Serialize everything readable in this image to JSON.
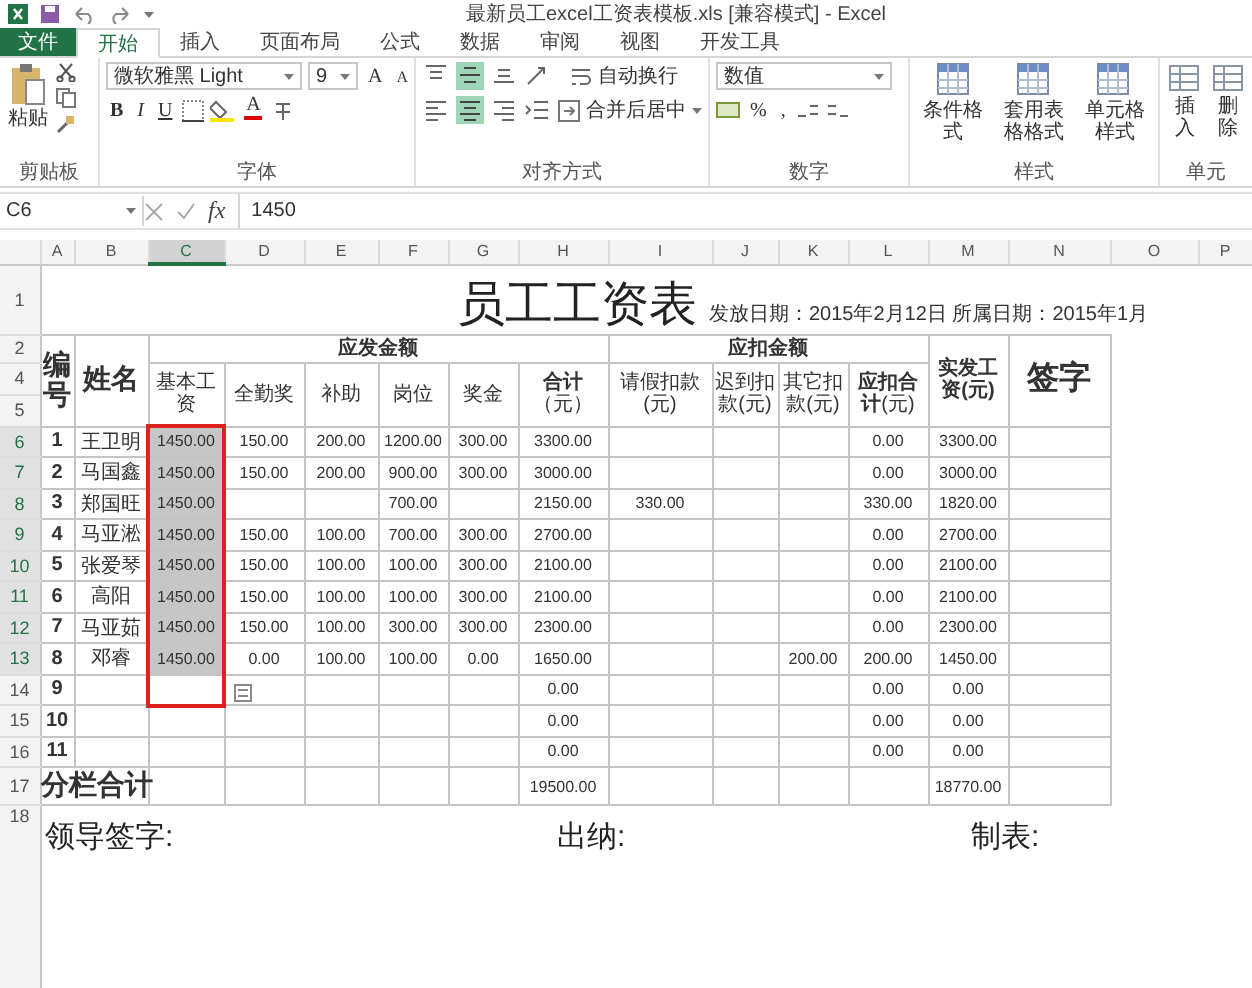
{
  "window": {
    "title": "最新员工excel工资表模板.xls  [兼容模式] - Excel"
  },
  "tabs": [
    {
      "label": "文件",
      "kind": "file",
      "selected": false
    },
    {
      "label": "开始",
      "kind": "tab",
      "selected": true
    },
    {
      "label": "插入",
      "kind": "tab",
      "selected": false
    },
    {
      "label": "页面布局",
      "kind": "tab",
      "selected": false
    },
    {
      "label": "公式",
      "kind": "tab",
      "selected": false
    },
    {
      "label": "数据",
      "kind": "tab",
      "selected": false
    },
    {
      "label": "审阅",
      "kind": "tab",
      "selected": false
    },
    {
      "label": "视图",
      "kind": "tab",
      "selected": false
    },
    {
      "label": "开发工具",
      "kind": "tab",
      "selected": false
    }
  ],
  "ribbon": {
    "clipboard": {
      "paste": "粘贴",
      "label": "剪贴板"
    },
    "font": {
      "name": "微软雅黑 Light",
      "size": "9",
      "bold": "B",
      "italic": "I",
      "underline": "U",
      "grow": "A",
      "shrink": "A",
      "color_button": "A",
      "label": "字体"
    },
    "alignment": {
      "vertical": [
        {
          "kind": "top",
          "selected": false
        },
        {
          "kind": "middle",
          "selected": true
        },
        {
          "kind": "bottom",
          "selected": false
        }
      ],
      "horizontal": [
        {
          "kind": "left",
          "selected": false
        },
        {
          "kind": "center",
          "selected": true
        },
        {
          "kind": "right",
          "selected": false
        }
      ],
      "wrap": "自动换行",
      "merge": "合并后居中",
      "label": "对齐方式"
    },
    "number": {
      "format": "数值",
      "percent": "%",
      "comma": ",",
      "label": "数字"
    },
    "styles": {
      "buttons": [
        "条件格式",
        "套用表格格式",
        "单元格样式"
      ],
      "label": "样式"
    },
    "cells": {
      "buttons": [
        "插入",
        "删除"
      ],
      "label": "单元"
    }
  },
  "formula_bar": {
    "name_box": "C6",
    "fx": "fx",
    "value": "1450"
  },
  "sheet": {
    "columns": [
      {
        "label": "A",
        "selected": false
      },
      {
        "label": "B",
        "selected": false
      },
      {
        "label": "C",
        "selected": true
      },
      {
        "label": "D",
        "selected": false
      },
      {
        "label": "E",
        "selected": false
      },
      {
        "label": "F",
        "selected": false
      },
      {
        "label": "G",
        "selected": false
      },
      {
        "label": "H",
        "selected": false
      },
      {
        "label": "I",
        "selected": false
      },
      {
        "label": "J",
        "selected": false
      },
      {
        "label": "K",
        "selected": false
      },
      {
        "label": "L",
        "selected": false
      },
      {
        "label": "M",
        "selected": false
      },
      {
        "label": "N",
        "selected": false
      },
      {
        "label": "O",
        "selected": false
      },
      {
        "label": "P",
        "selected": false
      }
    ],
    "title_row": {
      "number": "1",
      "title": "员工工资表",
      "dates": "发放日期：2015年2月12日 所属日期：2015年1月"
    },
    "header": {
      "numbers": [
        "2",
        "4",
        "5"
      ],
      "id": "编号",
      "name": "姓名",
      "earn_group": "应发金额",
      "earn_columns": [
        "基本工资",
        "全勤奖",
        "补助",
        "岗位",
        "奖金",
        "**合计**（元）"
      ],
      "deduct_group": "应扣金额",
      "deduct_columns": [
        "请假扣款(元)",
        "迟到扣款(元)",
        "其它扣款(元)",
        "**应扣合计**(元)"
      ],
      "net": "实发工资(元)",
      "sign": "签字"
    },
    "rows": [
      {
        "number": "6",
        "selected": true,
        "cells": [
          "1",
          "王卫明",
          "1450.00",
          "150.00",
          "200.00",
          "1200.00",
          "300.00",
          "3300.00",
          "",
          "",
          "",
          "0.00",
          "3300.00"
        ]
      },
      {
        "number": "7",
        "selected": true,
        "cells": [
          "2",
          "马国鑫",
          "1450.00",
          "150.00",
          "200.00",
          "900.00",
          "300.00",
          "3000.00",
          "",
          "",
          "",
          "0.00",
          "3000.00"
        ]
      },
      {
        "number": "8",
        "selected": true,
        "cells": [
          "3",
          "郑国旺",
          "1450.00",
          "",
          "",
          "700.00",
          "",
          "2150.00",
          "330.00",
          "",
          "",
          "330.00",
          "1820.00"
        ]
      },
      {
        "number": "9",
        "selected": true,
        "cells": [
          "4",
          "马亚淞",
          "1450.00",
          "150.00",
          "100.00",
          "700.00",
          "300.00",
          "2700.00",
          "",
          "",
          "",
          "0.00",
          "2700.00"
        ]
      },
      {
        "number": "10",
        "selected": true,
        "cells": [
          "5",
          "张爱琴",
          "1450.00",
          "150.00",
          "100.00",
          "100.00",
          "300.00",
          "2100.00",
          "",
          "",
          "",
          "0.00",
          "2100.00"
        ]
      },
      {
        "number": "11",
        "selected": true,
        "cells": [
          "6",
          "高阳",
          "1450.00",
          "150.00",
          "100.00",
          "100.00",
          "300.00",
          "2100.00",
          "",
          "",
          "",
          "0.00",
          "2100.00"
        ]
      },
      {
        "number": "12",
        "selected": true,
        "cells": [
          "7",
          "马亚茹",
          "1450.00",
          "150.00",
          "100.00",
          "300.00",
          "300.00",
          "2300.00",
          "",
          "",
          "",
          "0.00",
          "2300.00"
        ]
      },
      {
        "number": "13",
        "selected": true,
        "cells": [
          "8",
          "邓睿",
          "1450.00",
          "0.00",
          "100.00",
          "100.00",
          "0.00",
          "1650.00",
          "",
          "",
          "200.00",
          "200.00",
          "1450.00"
        ]
      },
      {
        "number": "14",
        "selected": false,
        "cells": [
          "9",
          "",
          "",
          "",
          "",
          "",
          "",
          "0.00",
          "",
          "",
          "",
          "0.00",
          "0.00"
        ]
      },
      {
        "number": "15",
        "selected": false,
        "cells": [
          "10",
          "",
          "",
          "",
          "",
          "",
          "",
          "0.00",
          "",
          "",
          "",
          "0.00",
          "0.00"
        ]
      },
      {
        "number": "16",
        "selected": false,
        "cells": [
          "11",
          "",
          "",
          "",
          "",
          "",
          "",
          "0.00",
          "",
          "",
          "",
          "0.00",
          "0.00"
        ]
      }
    ],
    "total_row": {
      "number": "17",
      "cells": [
        "分栏合计",
        "",
        "",
        "",
        "",
        "",
        "",
        "19500.00",
        "",
        "",
        "",
        "",
        "18770.00"
      ]
    },
    "sign_row": {
      "number": "18",
      "items": [
        "领导签字:",
        "出纳:",
        "制表:"
      ]
    }
  }
}
